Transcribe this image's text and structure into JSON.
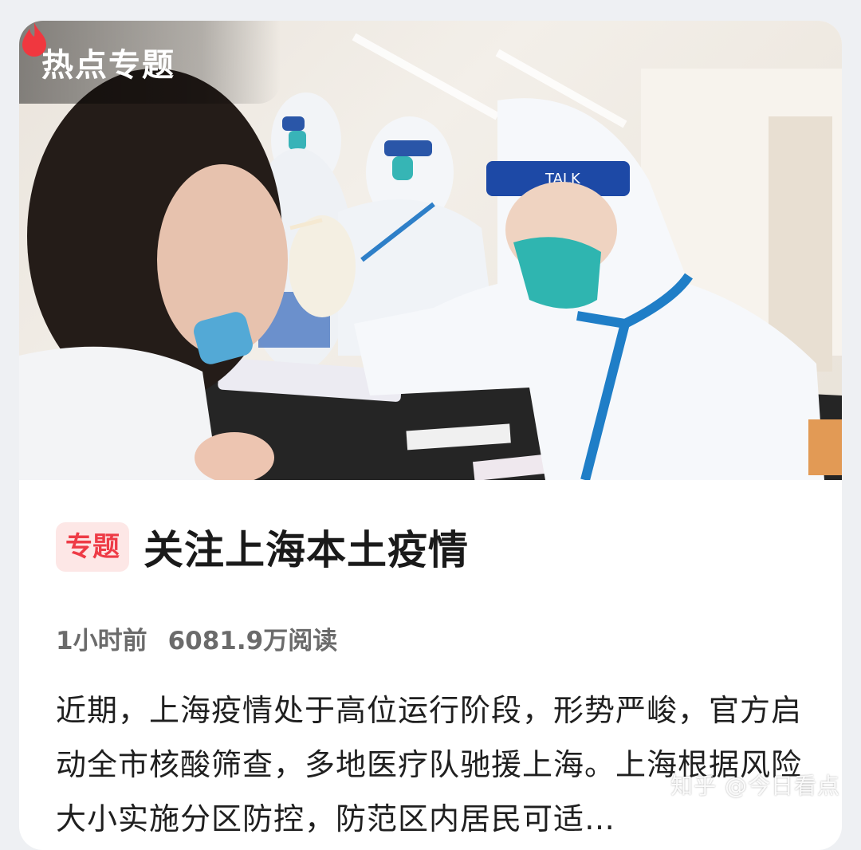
{
  "badge": {
    "label": "热点专题",
    "icon": "flame-icon",
    "icon_color": "#f0373f"
  },
  "topic": {
    "tag": "专题",
    "title": "关注上海本土疫情",
    "time": "1小时前",
    "reads": "6081.9万阅读",
    "description": "近期，上海疫情处于高位运行阶段，形势严峻，官方启动全市核酸筛查，多地医疗队驰援上海。上海根据风险大小实施分区防控，防范区内居民可适…"
  },
  "watermark": "知乎 @今日看点",
  "colors": {
    "accent": "#ee3b46",
    "tag_bg": "#fde7e6",
    "title": "#1a1a1a",
    "meta": "#6b6b6b"
  }
}
